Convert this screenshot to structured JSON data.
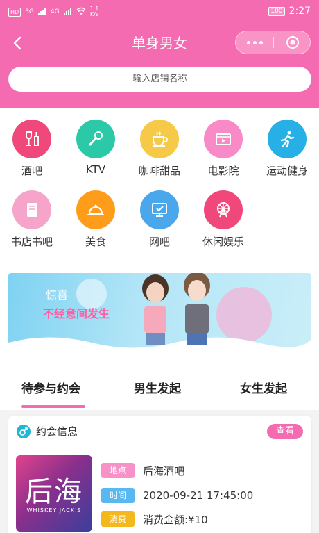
{
  "status": {
    "hd": "HD",
    "sig1": "3G",
    "sig2": "4G",
    "speed_value": "1.1",
    "speed_unit": "K/s",
    "battery": "100",
    "time": "2:27"
  },
  "header": {
    "title": "单身男女",
    "search_placeholder": "输入店铺名称"
  },
  "categories": [
    {
      "label": "酒吧",
      "icon": "wine-icon",
      "color": "#f0487a"
    },
    {
      "label": "KTV",
      "icon": "microphone-icon",
      "color": "#2cc9a8"
    },
    {
      "label": "咖啡甜品",
      "icon": "coffee-icon",
      "color": "#f7c948"
    },
    {
      "label": "电影院",
      "icon": "film-icon",
      "color": "#f88ac7"
    },
    {
      "label": "运动健身",
      "icon": "running-icon",
      "color": "#27b0e6"
    },
    {
      "label": "书店书吧",
      "icon": "book-icon",
      "color": "#f6a4c9"
    },
    {
      "label": "美食",
      "icon": "food-cloche-icon",
      "color": "#ff9d1a"
    },
    {
      "label": "网吧",
      "icon": "monitor-icon",
      "color": "#4ba7ec"
    },
    {
      "label": "休闲娱乐",
      "icon": "ferris-wheel-icon",
      "color": "#f0487a"
    }
  ],
  "banner": {
    "line1": "惊喜",
    "line2": "不经意间发生"
  },
  "tabs": [
    "待参与约会",
    "男生发起",
    "女生发起"
  ],
  "card": {
    "title": "约会信息",
    "view_label": "查看",
    "shop_logo_text": "后海",
    "shop_logo_sub": "WHISKEY JACK'S",
    "rows": [
      {
        "tag": "地点",
        "value": "后海酒吧",
        "color": "#f891c8"
      },
      {
        "tag": "时间",
        "value": "2020-09-21 17:45:00",
        "color": "#59b8ef"
      },
      {
        "tag": "消费",
        "value": "消费金额:¥10",
        "color": "#f5b81c"
      }
    ]
  }
}
